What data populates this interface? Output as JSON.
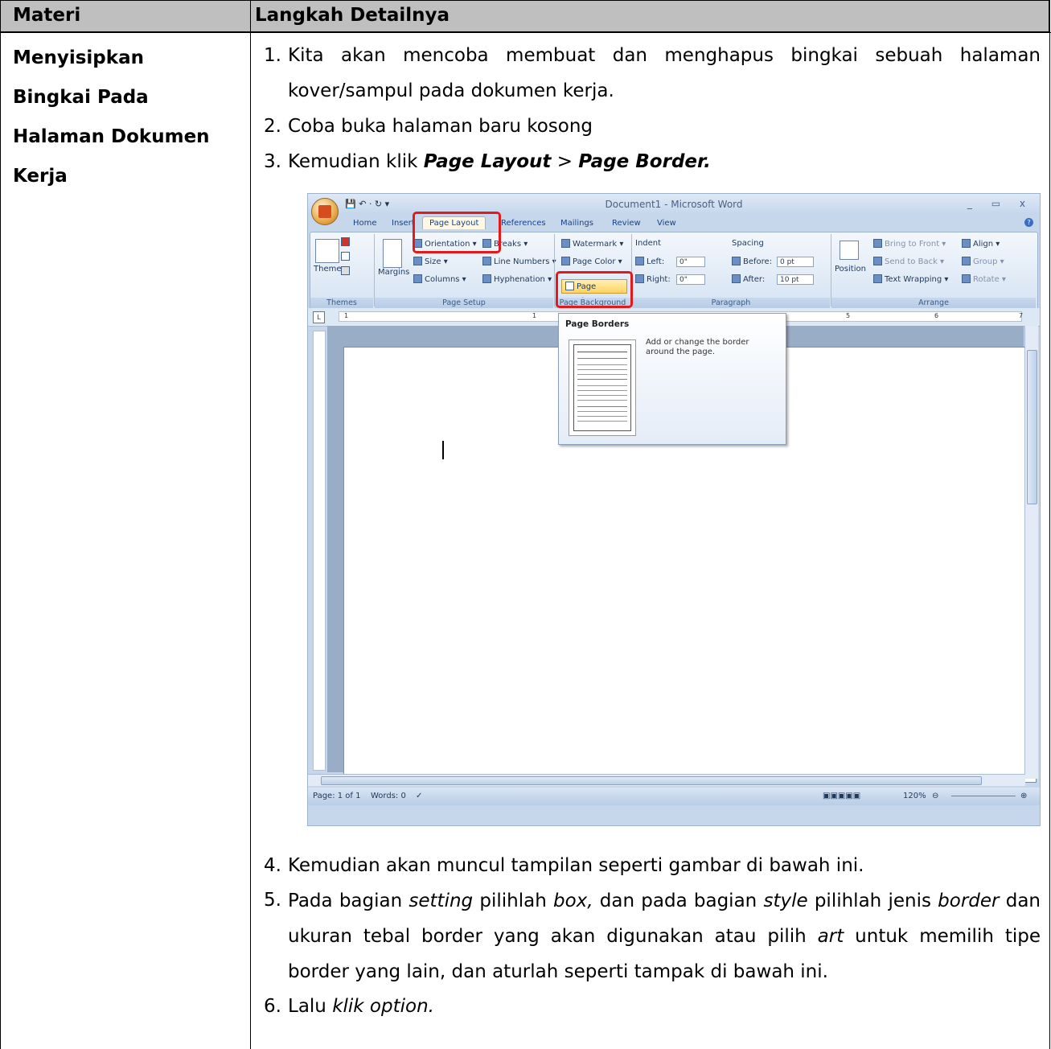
{
  "table": {
    "header": {
      "col1": "Materi",
      "col2": "Langkah Detailnya"
    },
    "materi_lines": [
      "Menyisipkan",
      "Bingkai Pada",
      "Halaman Dokumen",
      "Kerja"
    ],
    "steps_top": [
      {
        "num": "1.",
        "text": "Kita akan mencoba membuat dan menghapus bingkai sebuah halaman kover/sampul pada dokumen kerja."
      },
      {
        "num": "2.",
        "text": "Coba buka halaman baru kosong"
      }
    ],
    "step3": {
      "num": "3.",
      "prefix": "Kemudian klik ",
      "menu1": "Page Layout",
      "sep": " > ",
      "menu2": "Page Border."
    },
    "step4": {
      "num": "4.",
      "text": "Kemudian akan muncul tampilan seperti gambar di bawah ini."
    },
    "step5": {
      "num": "5.",
      "t1": "Pada bagian ",
      "i1": "setting",
      "t2": " pilihlah ",
      "i2": "box,",
      "t3": " dan pada bagian ",
      "i3": "style",
      "t4": " pilihlah jenis ",
      "i4": "border",
      "t5": " dan ukuran tebal border yang akan digunakan atau pilih ",
      "i5": "art",
      "t6": " untuk memilih tipe border yang lain, dan aturlah seperti tampak di bawah ini."
    },
    "step6": {
      "num": "6.",
      "prefix": "Lalu ",
      "italic": "klik option."
    }
  },
  "word": {
    "window_title": "Document1 - Microsoft Word",
    "window_controls": "_ ▭ x",
    "tabs": [
      "Home",
      "Insert",
      "Page Layout",
      "References",
      "Mailings",
      "Review",
      "View"
    ],
    "active_tab": "Page Layout",
    "groups": [
      "Themes",
      "Page Setup",
      "Page Background",
      "Paragraph",
      "Arrange"
    ],
    "themes_label": "Themes",
    "margins_label": "Margins",
    "page_setup_items": [
      "Orientation ▾",
      "Size ▾",
      "Columns ▾",
      "Breaks ▾",
      "Line Numbers ▾",
      "Hyphenation ▾"
    ],
    "page_bg_items": [
      "Watermark ▾",
      "Page Color ▾",
      "Page Borders"
    ],
    "indent": {
      "label": "Indent",
      "left_label": "Left:",
      "left_val": "0\"",
      "right_label": "Right:",
      "right_val": "0\""
    },
    "spacing": {
      "label": "Spacing",
      "before_label": "Before:",
      "before_val": "0 pt",
      "after_label": "After:",
      "after_val": "10 pt"
    },
    "arrange_items": [
      "Bring to Front ▾",
      "Send to Back ▾",
      "Text Wrapping ▾",
      "Align ▾",
      "Group ▾",
      "Rotate ▾"
    ],
    "position_label": "Position",
    "ruler_marks": [
      "1",
      "1",
      "5",
      "6",
      "7"
    ],
    "tooltip": {
      "title": "Page Borders",
      "desc": "Add or change the border around the page."
    },
    "status": {
      "page": "Page: 1 of 1",
      "words": "Words: 0",
      "zoom": "120%"
    },
    "highlight_color": "#e11b1b"
  }
}
